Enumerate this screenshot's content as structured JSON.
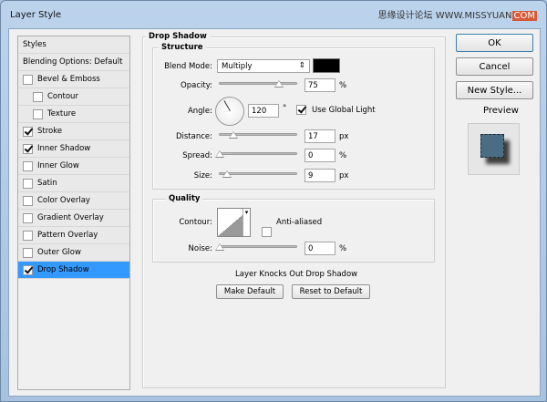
{
  "window": {
    "title": "Layer Style",
    "watermark": "思缘设计论坛 WWW.MISSYUAN",
    "watermark_tail": "COM"
  },
  "styles_list": {
    "header": "Styles",
    "blending": "Blending Options: Default",
    "items": [
      {
        "label": "Bevel & Emboss",
        "checked": false,
        "indent": false
      },
      {
        "label": "Contour",
        "checked": false,
        "indent": true
      },
      {
        "label": "Texture",
        "checked": false,
        "indent": true
      },
      {
        "label": "Stroke",
        "checked": true,
        "indent": false
      },
      {
        "label": "Inner Shadow",
        "checked": true,
        "indent": false
      },
      {
        "label": "Inner Glow",
        "checked": false,
        "indent": false
      },
      {
        "label": "Satin",
        "checked": false,
        "indent": false
      },
      {
        "label": "Color Overlay",
        "checked": false,
        "indent": false
      },
      {
        "label": "Gradient Overlay",
        "checked": false,
        "indent": false
      },
      {
        "label": "Pattern Overlay",
        "checked": false,
        "indent": false
      },
      {
        "label": "Outer Glow",
        "checked": false,
        "indent": false
      },
      {
        "label": "Drop Shadow",
        "checked": true,
        "indent": false,
        "selected": true
      }
    ]
  },
  "panel": {
    "title": "Drop Shadow",
    "structure": {
      "title": "Structure",
      "blend_mode_label": "Blend Mode:",
      "blend_mode": "Multiply",
      "shadow_color": "#000000",
      "opacity_label": "Opacity:",
      "opacity": "75",
      "opacity_unit": "%",
      "angle_label": "Angle:",
      "angle": "120",
      "angle_unit": "°",
      "global_light_label": "Use Global Light",
      "global_light": true,
      "distance_label": "Distance:",
      "distance": "17",
      "distance_unit": "px",
      "spread_label": "Spread:",
      "spread": "0",
      "spread_unit": "%",
      "size_label": "Size:",
      "size": "9",
      "size_unit": "px"
    },
    "quality": {
      "title": "Quality",
      "contour_label": "Contour:",
      "anti_aliased_label": "Anti-aliased",
      "anti_aliased": false,
      "noise_label": "Noise:",
      "noise": "0",
      "noise_unit": "%"
    },
    "knockout_label": "Layer Knocks Out Drop Shadow",
    "knockout": true,
    "make_default": "Make Default",
    "reset_default": "Reset to Default"
  },
  "buttons": {
    "ok": "OK",
    "cancel": "Cancel",
    "new_style": "New Style...",
    "preview_label": "Preview",
    "preview": true,
    "accent": "#3399ff"
  }
}
